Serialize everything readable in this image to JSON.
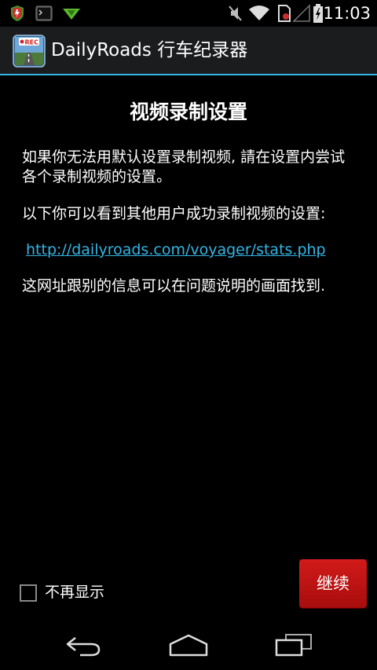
{
  "status_bar": {
    "time": "11:03",
    "icons": [
      "app-security-icon",
      "terminal-icon",
      "download-icon",
      "mute-icon",
      "wifi-icon",
      "no-sim-icon",
      "signal-icon",
      "battery-charging-icon"
    ]
  },
  "action_bar": {
    "app_icon": "rec-camera-icon",
    "title": "DailyRoads 行车纪录器"
  },
  "content": {
    "heading": "视频录制设置",
    "paragraph1": "如果你无法用默认设置录制视频, 請在设置内尝试各个录制视频的设置。",
    "paragraph2": "以下你可以看到其他用户成功录制视频的设置:",
    "link": "http://dailyroads.com/voyager/stats.php",
    "paragraph3": "这网址跟别的信息可以在问题说明的画面找到."
  },
  "footer": {
    "checkbox_label": "不再显示",
    "checkbox_checked": false,
    "continue_label": "继续"
  },
  "nav_bar": {
    "icons": [
      "back-icon",
      "home-icon",
      "recent-apps-icon"
    ]
  },
  "colors": {
    "accent": "#33b5e5",
    "button": "#c41414",
    "background": "#000000",
    "action_bar": "#1b1c1e"
  }
}
